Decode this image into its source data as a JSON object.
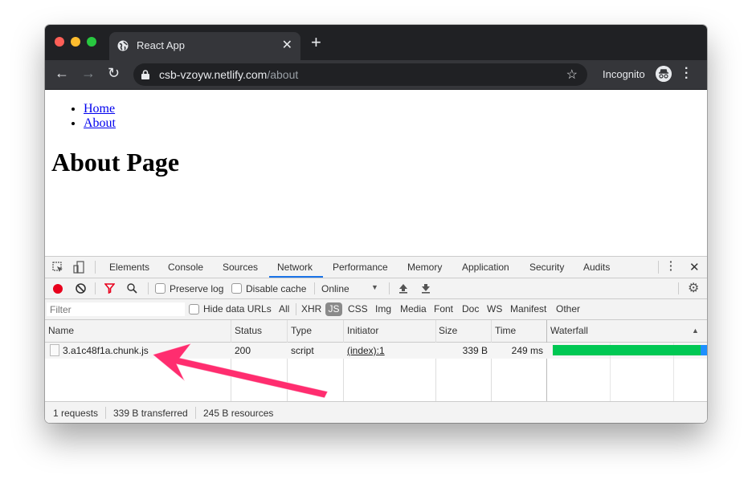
{
  "browser": {
    "tab_title": "React App",
    "url_host": "csb-vzoyw.netlify.com",
    "url_path": "/about",
    "incognito_label": "Incognito",
    "traffic_lights": {
      "close": "#ff5f57",
      "minimize": "#febc2e",
      "maximize": "#28c840"
    }
  },
  "page": {
    "nav_links": [
      {
        "label": "Home"
      },
      {
        "label": "About"
      }
    ],
    "heading": "About Page"
  },
  "devtools": {
    "tabs": [
      {
        "label": "Elements"
      },
      {
        "label": "Console"
      },
      {
        "label": "Sources"
      },
      {
        "label": "Network",
        "active": true
      },
      {
        "label": "Performance"
      },
      {
        "label": "Memory"
      },
      {
        "label": "Application"
      },
      {
        "label": "Security"
      },
      {
        "label": "Audits"
      }
    ],
    "toolbar": {
      "preserve_log": "Preserve log",
      "disable_cache": "Disable cache",
      "throttle": "Online"
    },
    "filter_bar": {
      "filter_placeholder": "Filter",
      "hide_data_urls": "Hide data URLs",
      "types": [
        "All",
        "XHR",
        "JS",
        "CSS",
        "Img",
        "Media",
        "Font",
        "Doc",
        "WS",
        "Manifest",
        "Other"
      ],
      "active_type": "JS"
    },
    "table": {
      "columns": [
        "Name",
        "Status",
        "Type",
        "Initiator",
        "Size",
        "Time",
        "Waterfall"
      ],
      "rows": [
        {
          "name": "3.a1c48f1a.chunk.js",
          "status": "200",
          "type": "script",
          "initiator": "(index):1",
          "size": "339 B",
          "time": "249 ms"
        }
      ]
    },
    "status": {
      "requests": "1 requests",
      "transferred": "339 B transferred",
      "resources": "245 B resources"
    },
    "colors": {
      "accent": "#1a73e8",
      "record": "#e8001c",
      "waterfall_wait": "#00c853",
      "waterfall_download": "#1e90ff",
      "annotation_arrow": "#ff2d6f"
    }
  }
}
